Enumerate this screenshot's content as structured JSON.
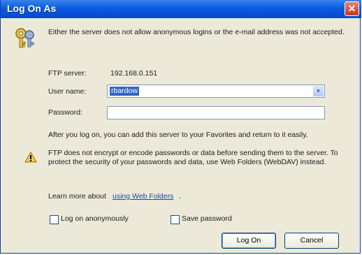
{
  "window": {
    "title": "Log On As",
    "close_icon": "close-icon"
  },
  "message": {
    "intro": "Either the server does not allow anonymous logins or the e-mail address was not accepted.",
    "after_logon": "After you log on, you can add this server to your Favorites and return to it easily.",
    "warning": "FTP does not encrypt or encode passwords or data before sending them to the server.  To protect the security of your passwords and data, use Web Folders (WebDAV) instead.",
    "learn_more_prefix": "Learn more about",
    "learn_more_link": "using Web Folders",
    "learn_more_suffix": "."
  },
  "form": {
    "ftp_server_label": "FTP server:",
    "ftp_server_value": "192.168.0.151",
    "user_name_label": "User name:",
    "user_name_value": "rbardow",
    "password_label": "Password:",
    "password_value": ""
  },
  "options": {
    "anonymous_label": "Log on anonymously",
    "save_password_label": "Save password"
  },
  "buttons": {
    "logon": "Log On",
    "cancel": "Cancel"
  },
  "icons": {
    "key": "key-icon",
    "warning": "warning-icon",
    "dropdown": "chevron-down-icon"
  },
  "colors": {
    "titlebar": "#0b5be0",
    "dialog_bg": "#ece9d8",
    "link": "#1c3fc4",
    "selection": "#3166c5"
  }
}
